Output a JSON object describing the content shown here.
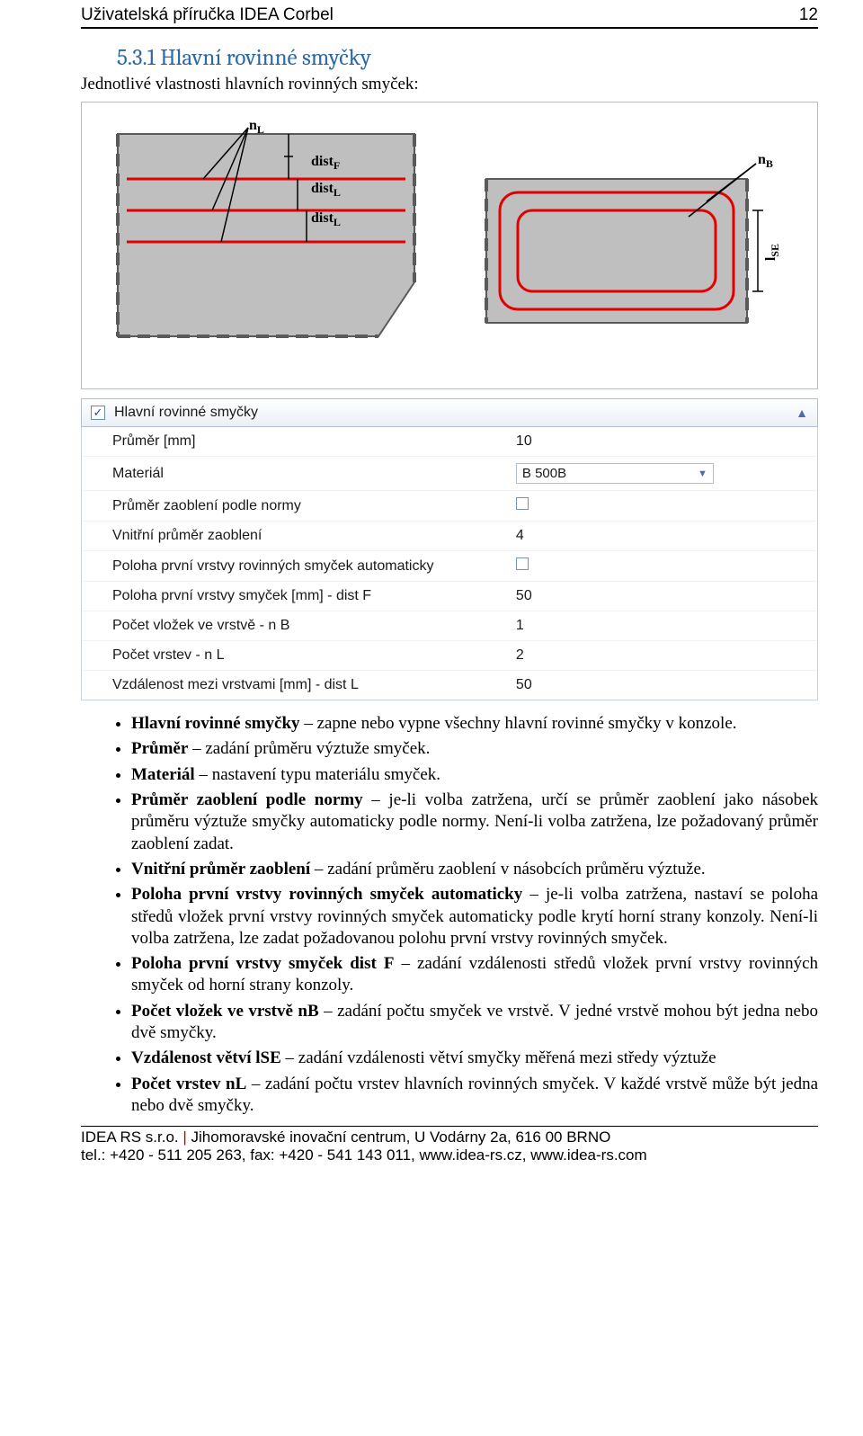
{
  "header": {
    "title": "Uživatelská příručka IDEA Corbel",
    "page_no": "12"
  },
  "section": {
    "heading": "5.3.1 Hlavní rovinné smyčky",
    "intro": "Jednotlivé vlastnosti hlavních rovinných smyček:"
  },
  "diagram": {
    "nL": "n",
    "nL_sub": "L",
    "distF": "dist",
    "distF_sub": "F",
    "distL1": "dist",
    "distL1_sub": "L",
    "distL2": "dist",
    "distL2_sub": "L",
    "nB": "n",
    "nB_sub": "B",
    "lSE": "l",
    "lSE_sub": "SE"
  },
  "panel": {
    "title": "Hlavní rovinné smyčky",
    "checked": "✓",
    "chev": "▲"
  },
  "props": [
    {
      "label": "Průměr [mm]",
      "val": "10",
      "type": "text"
    },
    {
      "label": "Materiál",
      "val": "B 500B",
      "type": "combo"
    },
    {
      "label": "Průměr zaoblení podle normy",
      "val": "",
      "type": "check"
    },
    {
      "label": "Vnitřní průměr zaoblení",
      "val": "4",
      "type": "text"
    },
    {
      "label": "Poloha první vrstvy rovinných smyček automaticky",
      "val": "",
      "type": "check"
    },
    {
      "label": "Poloha první vrstvy smyček [mm] - dist F",
      "val": "50",
      "type": "text"
    },
    {
      "label": "Počet vložek ve vrstvě - n B",
      "val": "1",
      "type": "text"
    },
    {
      "label": "Počet vrstev - n L",
      "val": "2",
      "type": "text"
    },
    {
      "label": "Vzdálenost mezi vrstvami [mm] - dist L",
      "val": "50",
      "type": "text"
    }
  ],
  "bullets": [
    {
      "term": "Hlavní rovinné smyčky",
      "rest": " – zapne nebo vypne všechny hlavní rovinné smyčky v konzole."
    },
    {
      "term": "Průměr",
      "rest": " – zadání průměru výztuže smyček."
    },
    {
      "term": "Materiál",
      "rest": " – nastavení typu materiálu smyček."
    },
    {
      "term": "Průměr zaoblení podle normy",
      "rest": " – je-li volba zatržena, určí se průměr zaoblení jako násobek průměru výztuže smyčky automaticky podle normy. Není-li volba zatržena, lze požadovaný průměr zaoblení zadat."
    },
    {
      "term": "Vnitřní průměr zaoblení",
      "rest": " – zadání průměru zaoblení v násobcích průměru výztuže."
    },
    {
      "term": "Poloha první vrstvy rovinných smyček automaticky",
      "rest": " – je-li volba zatržena, nastaví se poloha středů vložek první vrstvy rovinných smyček automaticky podle krytí horní strany konzoly. Není-li volba zatržena, lze zadat požadovanou polohu první vrstvy rovinných smyček."
    },
    {
      "term": "Poloha první vrstvy smyček dist F",
      "rest": " – zadání vzdálenosti středů vložek první vrstvy rovinných smyček od horní strany konzoly."
    },
    {
      "term": "Počet vložek ve vrstvě nB",
      "rest": " – zadání počtu smyček ve vrstvě. V jedné vrstvě mohou být jedna nebo dvě smyčky."
    },
    {
      "term": "Vzdálenost větví lSE",
      "rest": " – zadání vzdálenosti větví smyčky měřená mezi středy výztuže"
    },
    {
      "term": "Počet vrstev nL",
      "rest": " – zadání počtu vrstev hlavních rovinných smyček. V každé vrstvě může být jedna nebo dvě smyčky."
    }
  ],
  "footer": {
    "company": "IDEA RS s.r.o.",
    "sep": " | ",
    "addr": "Jihomoravské inovační centrum, U Vodárny 2a, 616 00 BRNO",
    "line2": "tel.: +420 - 511 205 263, fax: +420 - 541 143 011, www.idea-rs.cz, www.idea-rs.com"
  }
}
